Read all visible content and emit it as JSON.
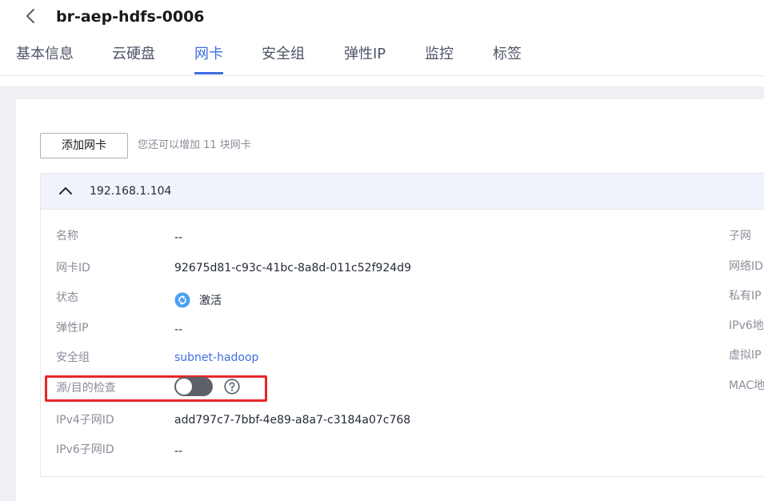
{
  "header": {
    "title": "br-aep-hdfs-0006",
    "back_icon": "chevron-left-icon"
  },
  "tabs": [
    {
      "label": "基本信息",
      "active": false
    },
    {
      "label": "云硬盘",
      "active": false
    },
    {
      "label": "网卡",
      "active": true
    },
    {
      "label": "安全组",
      "active": false
    },
    {
      "label": "弹性IP",
      "active": false
    },
    {
      "label": "监控",
      "active": false
    },
    {
      "label": "标签",
      "active": false
    }
  ],
  "toolbar": {
    "add_nic_label": "添加网卡",
    "hint": "您还可以增加 11 块网卡"
  },
  "nic": {
    "ip": "192.168.1.104",
    "fields": {
      "name": {
        "label": "名称",
        "value": "--"
      },
      "nic_id": {
        "label": "网卡ID",
        "value": "92675d81-c93c-41bc-8a8d-011c52f924d9"
      },
      "status": {
        "label": "状态",
        "value": "激活"
      },
      "eip": {
        "label": "弹性IP",
        "value": "--"
      },
      "security_group": {
        "label": "安全组",
        "value": "subnet-hadoop"
      },
      "src_dst_check": {
        "label": "源/目的检查",
        "enabled": false
      },
      "ipv4_subnet_id": {
        "label": "IPv4子网ID",
        "value": "add797c7-7bbf-4e89-a8a7-c3184a07c768"
      },
      "ipv6_subnet_id": {
        "label": "IPv6子网ID",
        "value": "--"
      }
    },
    "right_labels": [
      "子网",
      "网络ID",
      "私有IP",
      "IPv6地",
      "虚拟IP",
      "MAC地"
    ]
  },
  "colors": {
    "accent": "#3f6de0",
    "highlight": "#e8262a",
    "status_active": "#4aa0f5"
  }
}
